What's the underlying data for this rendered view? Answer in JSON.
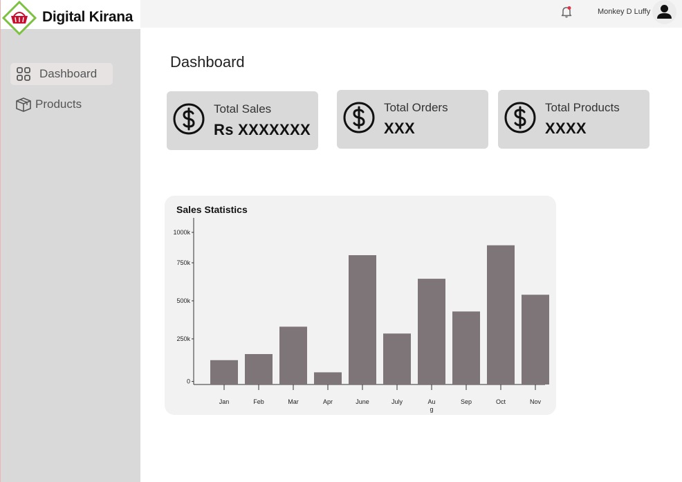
{
  "brand": {
    "name": "Digital Kirana",
    "logo": "basket-logo",
    "accent": "#7dc142",
    "logo_red": "#c8102e"
  },
  "sidebar": {
    "items": [
      {
        "label": "Dashboard",
        "icon": "grid-icon",
        "active": true
      },
      {
        "label": "Products",
        "icon": "box-icon",
        "active": false
      }
    ]
  },
  "header": {
    "user_name": "Monkey D Luffy",
    "notification_icon": "bell-icon",
    "avatar_icon": "user-icon"
  },
  "page": {
    "title": "Dashboard"
  },
  "cards": [
    {
      "label": "Total Sales",
      "value": "Rs XXXXXXX",
      "icon": "dollar-icon"
    },
    {
      "label": "Total Orders",
      "value": "XXX",
      "icon": "dollar-icon"
    },
    {
      "label": "Total Products",
      "value": "XXXX",
      "icon": "dollar-icon"
    }
  ],
  "chart_data": {
    "type": "bar",
    "title": "Sales Statistics",
    "categories": [
      "Jan",
      "Feb",
      "Mar",
      "Apr",
      "June",
      "July",
      "Au\ng",
      "Sep",
      "Oct",
      "Nov"
    ],
    "values": [
      160000,
      200000,
      380000,
      80000,
      850000,
      335000,
      695000,
      480000,
      915000,
      590000
    ],
    "yticks": [
      {
        "label": "1000k",
        "value": 1000000
      },
      {
        "label": "750k",
        "value": 800000
      },
      {
        "label": "500k",
        "value": 550000
      },
      {
        "label": "250k",
        "value": 300000
      },
      {
        "label": "0",
        "value": 20000
      }
    ],
    "ylim": [
      0,
      1050000
    ],
    "bar_color": "#7d7577",
    "xlabel": "",
    "ylabel": ""
  }
}
